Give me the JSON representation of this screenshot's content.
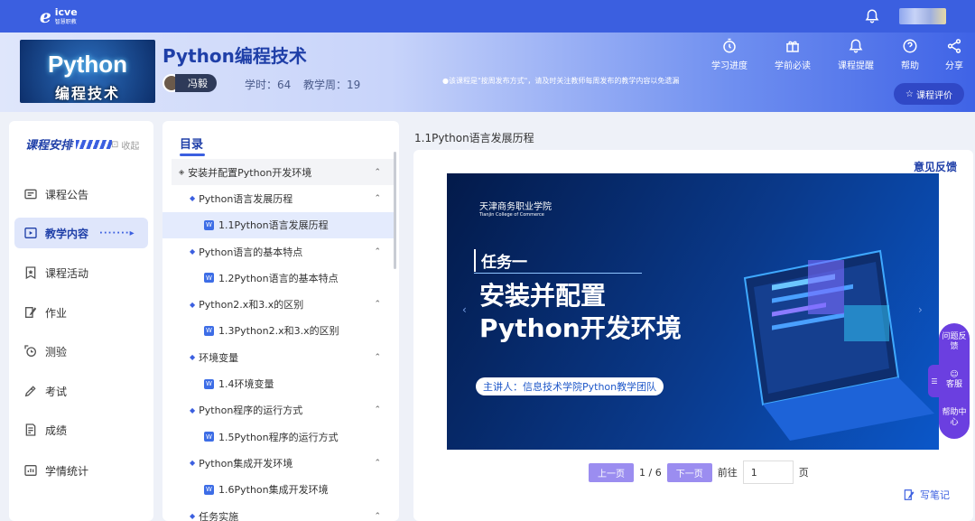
{
  "brand": {
    "logo_text": "icve",
    "logo_sub": "智慧职教"
  },
  "course": {
    "cover_line1": "Python",
    "cover_line2": "编程技术",
    "title": "Python编程技术",
    "teacher": "冯毅",
    "hours": "学时：64",
    "weeks": "教学周：19",
    "notice": "●该课程是\"按周发布方式\"，请及时关注教师每周发布的教学内容以免遗漏"
  },
  "header_actions": [
    {
      "label": "学习进度",
      "icon": "stopwatch-icon"
    },
    {
      "label": "学前必读",
      "icon": "gift-icon"
    },
    {
      "label": "课程提醒",
      "icon": "bell-icon"
    },
    {
      "label": "帮助",
      "icon": "help-icon"
    },
    {
      "label": "分享",
      "icon": "share-icon"
    }
  ],
  "rate_button": "课程评价",
  "sidebar": {
    "plan_label": "课程安排",
    "collapse_label": "收起",
    "items": [
      {
        "label": "课程公告",
        "icon": "announcement-icon"
      },
      {
        "label": "教学内容",
        "icon": "play-icon",
        "active": true
      },
      {
        "label": "课程活动",
        "icon": "star-icon"
      },
      {
        "label": "作业",
        "icon": "edit-icon"
      },
      {
        "label": "测验",
        "icon": "quiz-icon"
      },
      {
        "label": "考试",
        "icon": "pen-icon"
      },
      {
        "label": "成绩",
        "icon": "grade-icon"
      },
      {
        "label": "学情统计",
        "icon": "stats-icon"
      }
    ]
  },
  "directory": {
    "title": "目录",
    "rows": [
      {
        "level": 0,
        "label": "安装并配置Python开发环境"
      },
      {
        "level": 1,
        "label": "Python语言发展历程"
      },
      {
        "level": 2,
        "label": "1.1Python语言发展历程",
        "selected": true
      },
      {
        "level": 1,
        "label": "Python语言的基本特点"
      },
      {
        "level": 2,
        "label": "1.2Python语言的基本特点"
      },
      {
        "level": 1,
        "label": "Python2.x和3.x的区别"
      },
      {
        "level": 2,
        "label": "1.3Python2.x和3.x的区别"
      },
      {
        "level": 1,
        "label": "环境变量"
      },
      {
        "level": 2,
        "label": "1.4环境变量"
      },
      {
        "level": 1,
        "label": "Python程序的运行方式"
      },
      {
        "level": 2,
        "label": "1.5Python程序的运行方式"
      },
      {
        "level": 1,
        "label": "Python集成开发环境"
      },
      {
        "level": 2,
        "label": "1.6Python集成开发环境"
      },
      {
        "level": 1,
        "label": "任务实施"
      }
    ]
  },
  "content": {
    "title": "1.1Python语言发展历程",
    "feedback": "意见反馈",
    "slide": {
      "school": "天津商务职业学院",
      "school_en": "Tianjin College of Commerce",
      "task": "任务一",
      "heading1": "安装并配置",
      "heading2": "Python开发环境",
      "speaker": "主讲人：信息技术学院Python教学团队"
    },
    "pager": {
      "prev": "上一页",
      "page_info": "1 / 6",
      "next": "下一页",
      "goto": "前往",
      "input_value": "1",
      "page_unit": "页"
    },
    "note": "写笔记"
  },
  "float_bar": {
    "items": [
      "问题反馈",
      "客服",
      "帮助中心"
    ],
    "tab": "☰"
  }
}
